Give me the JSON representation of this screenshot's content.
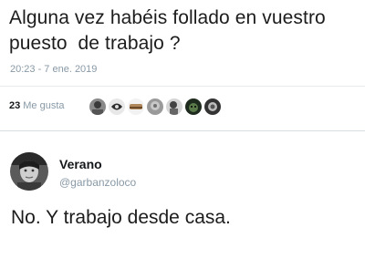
{
  "tweet": {
    "text_line1": "Alguna vez habéis follado en vuestro",
    "text_line2": "puesto  de trabajo ?",
    "timestamp": "20:23 - 7 ene. 2019"
  },
  "likes": {
    "count": "23",
    "label": "Me gusta",
    "avatars": [
      "avatar-1",
      "avatar-2",
      "avatar-3",
      "avatar-4",
      "avatar-5",
      "avatar-6",
      "avatar-7"
    ]
  },
  "reply": {
    "name": "Verano",
    "handle": "@garbanzoloco",
    "text": "No. Y trabajo desde casa."
  }
}
